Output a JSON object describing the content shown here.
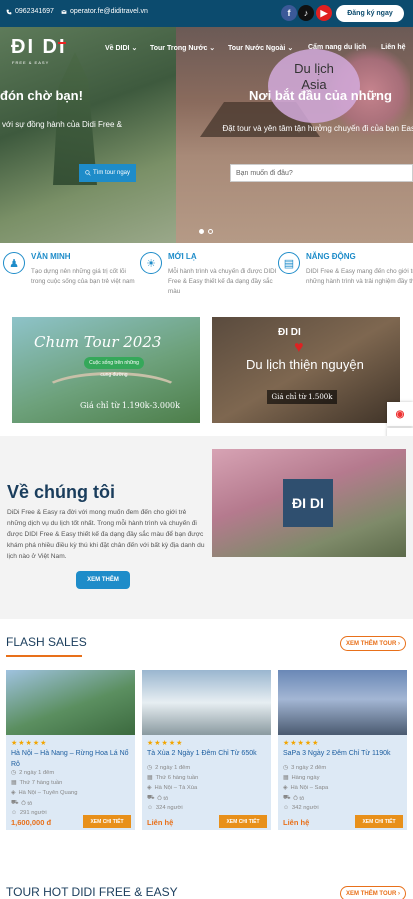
{
  "topbar": {
    "phone": "0962341697",
    "email": "operator.fe@diditravel.vn",
    "social_icons": [
      "facebook-icon",
      "tiktok-icon",
      "youtube-icon"
    ],
    "register_label": "Đăng ký ngay"
  },
  "header": {
    "logo": "ĐI DI",
    "tagline": "FREE & EASY",
    "nav": [
      "Về DIDI",
      "Tour Trong Nước",
      "Tour Nước Ngoài",
      "Cẩm nang du lịch",
      "Liên hệ"
    ]
  },
  "hero": {
    "heading_left": "đón chờ bạn!",
    "heading_right": "Nơi bắt đầu của những",
    "sub_left": "với sự đồng hành của Didi Free &",
    "sub_right": "Đặt tour và yên tâm tận hưởng chuyến đi của bạn Easy",
    "lantern_text": "Du lịch Asia",
    "find_button": "Tìm tour ngay",
    "ask_placeholder": "Bạn muốn đi đâu?"
  },
  "features": [
    {
      "title": "VĂN MINH",
      "desc": "Tạo dựng nên những giá trị cốt lõi trong cuộc sống của bạn trẻ việt nam",
      "icon": "chess-pawn-icon"
    },
    {
      "title": "MỚI LẠ",
      "desc": "Mỗi hành trình và chuyến đi được DIDI Free & Easy thiết kế đa dạng đầy sắc màu",
      "icon": "lightbulb-icon"
    },
    {
      "title": "NĂNG ĐỘNG",
      "desc": "DIDI Free & Easy mang đến cho giới trẻ những hành trình và trải nghiệm đầy thú vị.",
      "icon": "document-icon"
    }
  ],
  "banners": {
    "chum_tour": {
      "title": "Chum Tour 2023",
      "pill": "Cuộc sống trên những cung đường",
      "price": "Giá chỉ từ 1.190k-3.000k"
    },
    "charity": {
      "brand": "ĐI DI",
      "title": "Du lịch thiện nguyện",
      "price": "Giá chỉ từ 1.500k"
    }
  },
  "about": {
    "title": "Về chúng tôi",
    "text": "DiDi Free & Easy ra đời với mong muốn đem đến cho giới trẻ những dịch vụ du lịch tốt nhất. Trong mỗi hành trình và chuyến đi được DIDI Free & Easy thiết kế đa dạng đầy sắc màu để bạn được khám phá nhiều điều kỳ thú khi đặt chân đến với bất kỳ địa danh du lịch nào ở Việt Nam.",
    "button": "XEM THÊM",
    "image_logo": "ĐI DI"
  },
  "flash_sales": {
    "title": "FLASH SALES",
    "more": "XEM THÊM TOUR",
    "cards": [
      {
        "name": "Hà Nội – Hà Nang – Rừng Hoa Lá Nổ Rô",
        "stars": "★★★★★",
        "days": "2 ngày 1 đêm",
        "depart": "Thứ 7 hàng tuần",
        "route": "Hà Nội – Tuyên Quang",
        "vehicle": "Ô tô",
        "people": "291 người",
        "price": "1,600,000 đ",
        "button": "XEM CHI TIẾT"
      },
      {
        "name": "Tà Xùa 2 Ngày 1 Đêm Chỉ Từ 650k",
        "stars": "★★★★★",
        "days": "2 ngày 1 đêm",
        "depart": "Thứ 6 hàng tuần",
        "route": "Hà Nội – Tà Xùa",
        "vehicle": "Ô tô",
        "people": "324 người",
        "price": "Liên hệ",
        "button": "XEM CHI TIẾT"
      },
      {
        "name": "SaPa 3 Ngày 2 Đêm Chỉ Từ 1190k",
        "stars": "★★★★★",
        "days": "3 ngày 2 đêm",
        "depart": "Hàng ngày",
        "route": "Hà Nội – Sapa",
        "vehicle": "Ô tô",
        "people": "342 người",
        "price": "Liên hệ",
        "button": "XEM CHI TIẾT"
      }
    ]
  },
  "tour_hot": {
    "title": "TOUR HOT DIDI FREE & EASY",
    "more": "XEM THÊM TOUR"
  },
  "float_icons": [
    "chat-icon",
    "messenger-icon",
    "zalo-icon",
    "mail-icon"
  ],
  "colors": {
    "primary_blue": "#1e8cc9",
    "dark_navy": "#0c4b6e",
    "accent_orange": "#e8701a"
  }
}
